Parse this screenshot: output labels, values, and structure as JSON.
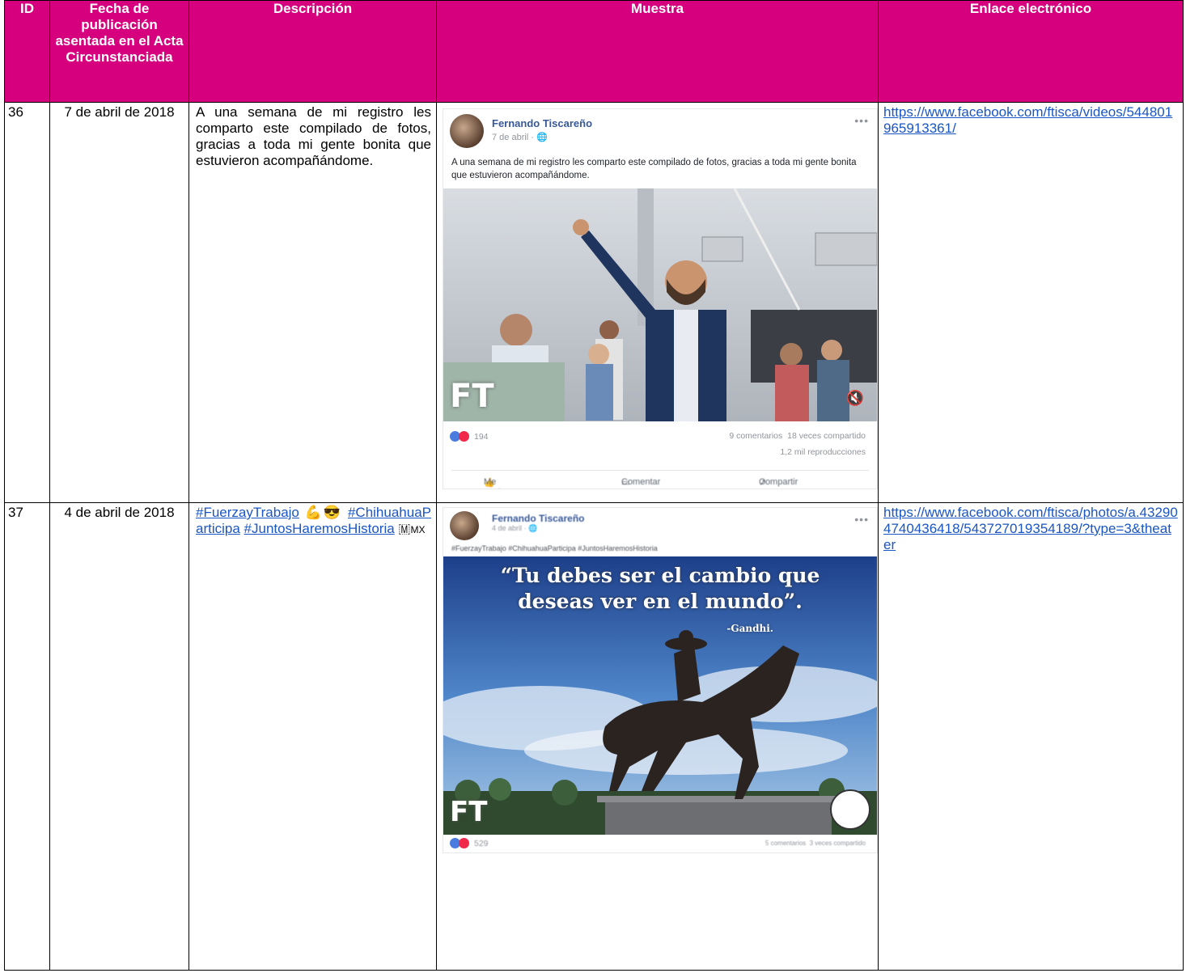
{
  "headers": {
    "id": "ID",
    "fecha": "Fecha de publicación asentada en el Acta Circunstanciada",
    "descripcion": "Descripción",
    "muestra": "Muestra",
    "enlace": "Enlace electrónico"
  },
  "rows": [
    {
      "id": "36",
      "fecha": "7 de abril de 2018",
      "descripcion": "A una semana de mi registro les comparto este compilado de fotos, gracias a toda mi gente bonita que estuvieron acompañándome.",
      "enlace": "https://www.facebook.com/ftisca/videos/544801965913361/",
      "post": {
        "author": "Fernando Tiscareño",
        "date": "7 de abril · ",
        "text": "A una semana de mi registro les comparto este compilado de fotos, gracias a toda mi gente bonita que estuvieron acompañándome.",
        "reaction_count": "194",
        "comments": "9 comentarios",
        "shares": "18 veces compartido",
        "views": "1,2 mil reproducciones",
        "actions": [
          "Me gusta",
          "Comentar",
          "Compartir"
        ],
        "logo": "FT"
      }
    },
    {
      "id": "37",
      "fecha": "4 de abril de 2018",
      "hashtags": [
        "#FuerzayTrabajo",
        "#ChihuahuaParticipa",
        "#JuntosHaremosHistoria"
      ],
      "descripcion_suffix": "MX",
      "enlace": "https://www.facebook.com/ftisca/photos/a.432904740436418/543727019354189/?type=3&theater",
      "post": {
        "author": "Fernando Tiscareño",
        "date": "4 de abril · ",
        "text": "#FuerzayTrabajo #ChihuahuaParticipa #JuntosHaremosHistoria",
        "quote": "“Tu debes ser el cambio que deseas ver en el mundo”.",
        "quote_author": "-Gandhi.",
        "reaction_count": "529",
        "comments": "5 comentarios",
        "shares": "3 veces compartido",
        "logo": "FT"
      }
    }
  ],
  "colors": {
    "header_bg": "#d6007e",
    "header_text": "#ffffff",
    "link": "#1a56c4",
    "fb_name": "#385898"
  }
}
